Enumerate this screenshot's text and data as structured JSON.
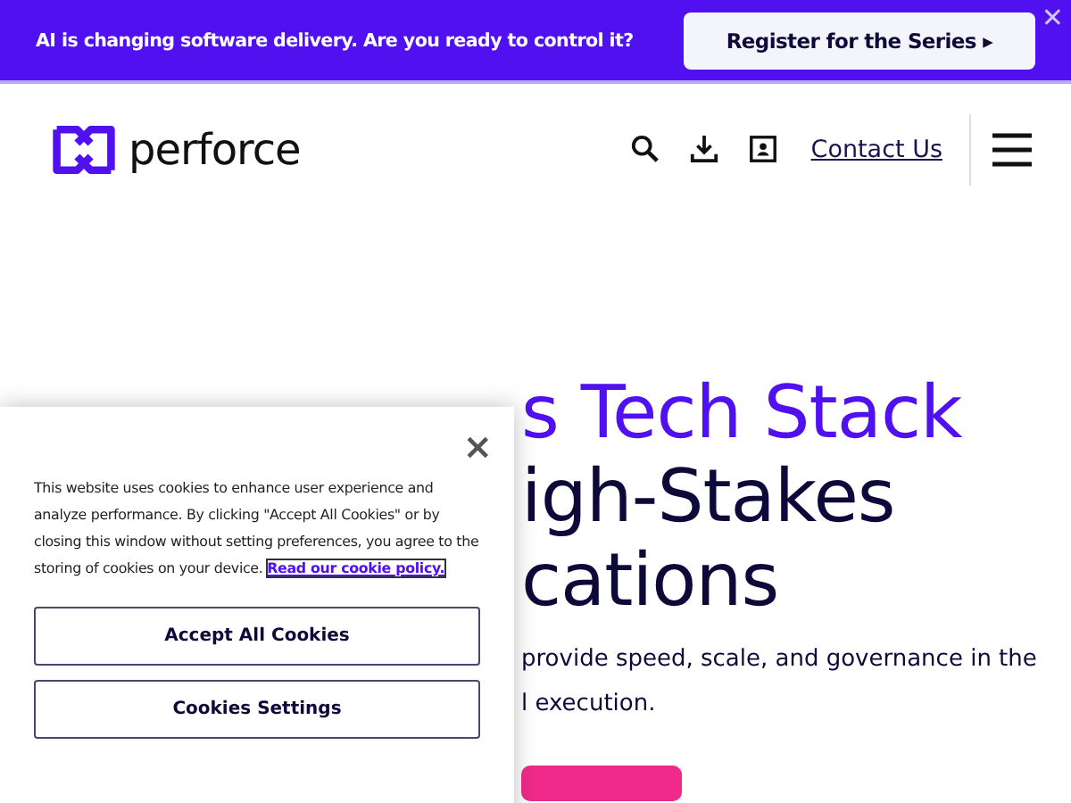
{
  "banner": {
    "text": "AI is changing software delivery. Are you ready to control it?",
    "button": "Register for the Series ▸",
    "close": "✕"
  },
  "header": {
    "logo": "perforce",
    "contact": "Contact Us"
  },
  "hero": {
    "title_lines": [
      {
        "text": "s Tech Stack",
        "accent": true
      },
      {
        "text": "igh-Stakes",
        "accent": false
      },
      {
        "text": "cations",
        "accent": false
      }
    ],
    "paragraph_lines": [
      "provide speed, scale, and governance in the",
      "l execution."
    ]
  },
  "cookie_panel": {
    "close": "×",
    "text": "This website uses cookies to enhance user experience and analyze performance. By clicking \"Accept All Cookies\" or by closing this window without setting preferences, you agree to the storing of cookies on your device.",
    "link": "Read our cookie policy.",
    "buttons": [
      "Accept All Cookies",
      "Cookies Settings"
    ]
  }
}
